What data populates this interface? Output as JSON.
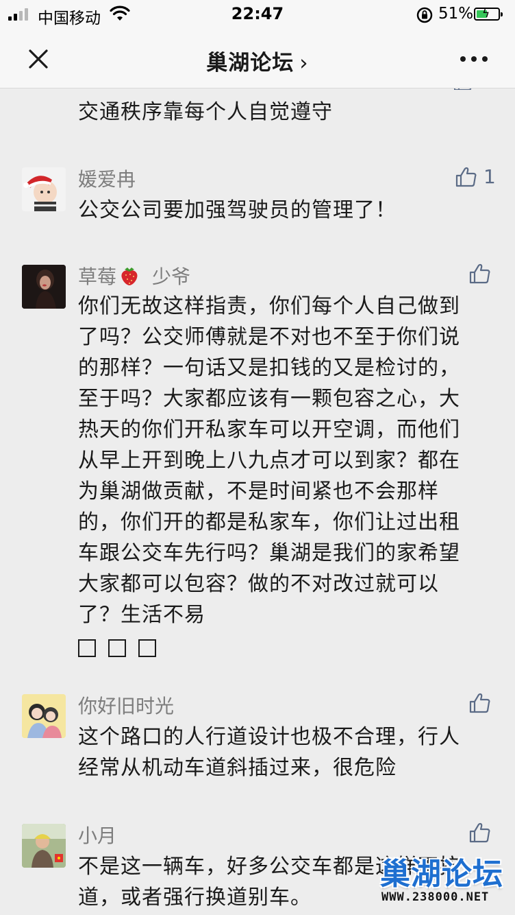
{
  "status_bar": {
    "carrier": "中国移动",
    "time": "22:47",
    "battery_percent": "51%",
    "battery_level": 0.51
  },
  "nav": {
    "title": "巢湖论坛",
    "chevron": "›"
  },
  "comments": [
    {
      "author": "",
      "author_extra": "",
      "text": "交通秩序靠每个人自觉遵守",
      "likes": ""
    },
    {
      "author": "媛爱冉",
      "author_extra": "",
      "text": "公交公司要加强驾驶员的管理了！",
      "likes": "1"
    },
    {
      "author": "草莓",
      "author_extra": "少爷",
      "text": "你们无故这样指责，你们每个人自己做到了吗？公交师傅就是不对也不至于你们说的那样？一句话又是扣钱的又是检讨的，至于吗？大家都应该有一颗包容之心，大热天的你们开私家车可以开空调，而他们从早上开到晚上八九点才可以到家？都在为巢湖做贡献，不是时间紧也不会那样的，你们开的都是私家车，你们让过出租车跟公交车先行吗？巢湖是我们的家希望大家都可以包容？做的不对改过就可以了？生活不易",
      "likes": ""
    },
    {
      "author": "你好旧时光",
      "author_extra": "",
      "text": "这个路口的人行道设计也极不合理，行人经常从机动车道斜插过来，很危险",
      "likes": ""
    },
    {
      "author": "小月",
      "author_extra": "",
      "text": "不是这一辆车，好多公交车都是这样不按道，或者强行换道别车。",
      "likes": ""
    }
  ],
  "watermark": {
    "name": "巢湖论坛",
    "url": "WWW.238000.NET"
  },
  "colors": {
    "background": "#ededed",
    "bar": "#f7f7f7",
    "author": "#7d7d7d",
    "like": "#5b6b86",
    "watermark": "#1e6fd0",
    "battery": "#35c759"
  }
}
